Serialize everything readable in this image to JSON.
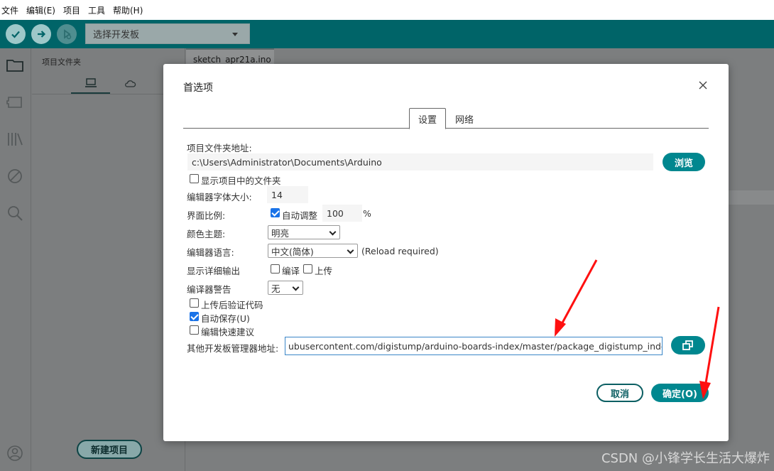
{
  "menu": [
    "文件",
    "编辑(E)",
    "项目",
    "工具",
    "帮助(H)"
  ],
  "toolbar": {
    "board_select": "选择开发板"
  },
  "sidebar": {
    "title": "项目文件夹",
    "new_project": "新建项目"
  },
  "editor": {
    "file_tab": "sketch_apr21a.ino"
  },
  "dialog": {
    "title": "首选项",
    "tabs": [
      "设置",
      "网络"
    ],
    "sketchbook_label": "项目文件夹地址:",
    "sketchbook_path": "c:\\Users\\Administrator\\Documents\\Arduino",
    "browse": "浏览",
    "show_files": "显示项目中的文件夹",
    "font_size_label": "编辑器字体大小:",
    "font_size": "14",
    "scale_label": "界面比例:",
    "auto_scale": "自动调整",
    "scale_value": "100",
    "scale_unit": "%",
    "theme_label": "颜色主题:",
    "theme_value": "明亮",
    "language_label": "编辑器语言:",
    "language_value": "中文(简体)",
    "reload_note": "(Reload required)",
    "verbose_label": "显示详细输出",
    "verbose_compile": "编译",
    "verbose_upload": "上传",
    "warnings_label": "编译器警告",
    "warnings_value": "无",
    "verify_after_upload": "上传后验证代码",
    "auto_save": "自动保存(U)",
    "quick_suggest": "编辑快速建议",
    "board_urls_label": "其他开发板管理器地址:",
    "board_urls_value": "ubusercontent.com/digistump/arduino-boards-index/master/package_digistump_index.json",
    "cancel": "取消",
    "ok": "确定(O)"
  },
  "checkbox_state": {
    "show_files": false,
    "auto_scale": true,
    "verbose_compile": false,
    "verbose_upload": false,
    "verify_after_upload": false,
    "auto_save": true,
    "quick_suggest": false
  },
  "watermark": "CSDN @小锋学长生活大爆炸",
  "colors": {
    "toolbar": "#006468",
    "accent": "#00878f",
    "annotation_arrow": "#ff0000"
  }
}
